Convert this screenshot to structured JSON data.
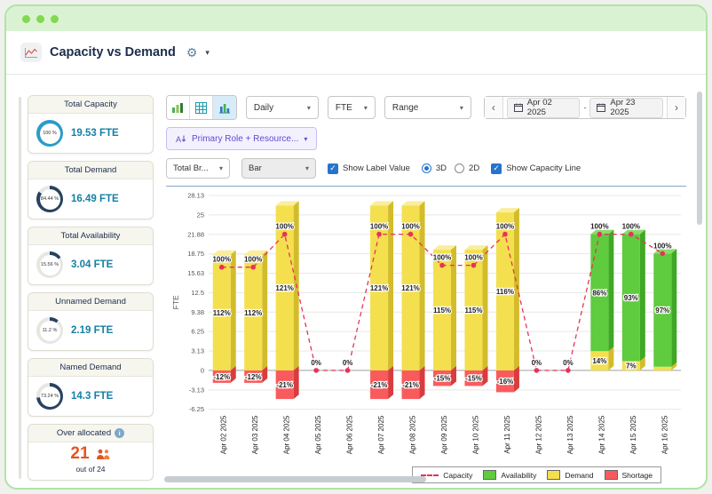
{
  "header": {
    "title": "Capacity vs Demand"
  },
  "icons": {
    "gear": "⚙",
    "caret_down": "▾",
    "chevron_left": "‹",
    "chevron_right": "›",
    "check": "✓",
    "info": "i",
    "date_separator": "-"
  },
  "sidebar": {
    "cards": [
      {
        "title": "Total Capacity",
        "percent": "100 %",
        "value": "19.53 FTE",
        "pct": 100,
        "ring": "#2D9BC7"
      },
      {
        "title": "Total Demand",
        "percent": "84.44 %",
        "value": "16.49 FTE",
        "pct": 84.44,
        "ring": "#27425F"
      },
      {
        "title": "Total Availability",
        "percent": "15.56 %",
        "value": "3.04 FTE",
        "pct": 15.56,
        "ring": "#27425F"
      },
      {
        "title": "Unnamed Demand",
        "percent": "11.2 %",
        "value": "2.19 FTE",
        "pct": 11.2,
        "ring": "#27425F"
      },
      {
        "title": "Named Demand",
        "percent": "73.24 %",
        "value": "14.3 FTE",
        "pct": 73.24,
        "ring": "#27425F"
      }
    ],
    "over_allocated": {
      "title": "Over allocated",
      "count": "21",
      "subtext": "out of 24",
      "count_color": "#e2551f"
    }
  },
  "toolbar": {
    "period": "Daily",
    "unit": "FTE",
    "range": "Range",
    "date_from": "Apr 02 2025",
    "date_to": "Apr 23 2025",
    "filter": "Primary Role + Resource...",
    "breakdown": "Total Br...",
    "chart_type": "Bar",
    "show_label_value": "Show Label Value",
    "mode_3d": "3D",
    "mode_2d": "2D",
    "show_capacity_line": "Show Capacity Line"
  },
  "chart_data": {
    "type": "bar",
    "render": "3d-stacked-bars-with-capacity-line",
    "title": "",
    "xlabel": "",
    "ylabel": "FTE",
    "ylim": [
      -6.25,
      28.13
    ],
    "yticks": [
      28.13,
      25,
      21.88,
      18.75,
      15.63,
      12.5,
      9.38,
      6.25,
      3.13,
      0,
      -3.13,
      -6.25
    ],
    "grid": true,
    "legend_position": "bottom-right",
    "categories": [
      "Apr 02 2025",
      "Apr 03 2025",
      "Apr 04 2025",
      "Apr 05 2025",
      "Apr 06 2025",
      "Apr 07 2025",
      "Apr 08 2025",
      "Apr 09 2025",
      "Apr 10 2025",
      "Apr 11 2025",
      "Apr 12 2025",
      "Apr 13 2025",
      "Apr 14 2025",
      "Apr 15 2025",
      "Apr 16 2025"
    ],
    "series": [
      {
        "name": "Capacity",
        "type": "line",
        "color": "#E8315B",
        "dashed": true,
        "values": [
          16.6,
          16.6,
          21.9,
          0,
          0,
          21.9,
          21.9,
          16.9,
          16.9,
          21.9,
          0,
          0,
          21.9,
          21.9,
          18.8
        ],
        "labels": [
          "100%",
          "100%",
          "100%",
          "0%",
          "0%",
          "100%",
          "100%",
          "100%",
          "100%",
          "100%",
          "0%",
          "0%",
          "100%",
          "100%",
          "100%"
        ]
      },
      {
        "name": "Availability",
        "type": "bar",
        "colors": {
          "front": "#5FCB3F",
          "side": "#3FA824",
          "top": "#8ADD6C"
        },
        "values": [
          0,
          0,
          0,
          0,
          0,
          0,
          0,
          0,
          0,
          0,
          0,
          0,
          18.8,
          20.4,
          18.2
        ],
        "labels": [
          "",
          "",
          "",
          "",
          "",
          "",
          "",
          "",
          "",
          "",
          "",
          "",
          "86%",
          "93%",
          "97%"
        ]
      },
      {
        "name": "Demand",
        "type": "bar",
        "colors": {
          "front": "#F4DF4E",
          "side": "#D3BC2B",
          "top": "#F9EE9C"
        },
        "values": [
          18.6,
          18.6,
          26.5,
          0,
          0,
          26.5,
          26.5,
          19.4,
          19.4,
          25.4,
          0,
          0,
          3.1,
          1.5,
          0.6
        ],
        "labels": [
          "112%",
          "112%",
          "121%",
          "",
          "",
          "121%",
          "121%",
          "115%",
          "115%",
          "116%",
          "",
          "",
          "14%",
          "7%",
          ""
        ]
      },
      {
        "name": "Shortage",
        "type": "bar",
        "colors": {
          "front": "#F95B5D",
          "side": "#D83C3E",
          "top": "#FB8B8D"
        },
        "values": [
          -2,
          -2,
          -4.6,
          0,
          0,
          -4.6,
          -4.6,
          -2.5,
          -2.5,
          -3.5,
          0,
          0,
          0,
          0,
          0
        ],
        "labels": [
          "-12%",
          "-12%",
          "-21%",
          "",
          "",
          "-21%",
          "-21%",
          "-15%",
          "-15%",
          "-16%",
          "",
          "",
          "",
          "",
          ""
        ]
      }
    ],
    "legend": [
      "Capacity",
      "Availability",
      "Demand",
      "Shortage"
    ]
  }
}
